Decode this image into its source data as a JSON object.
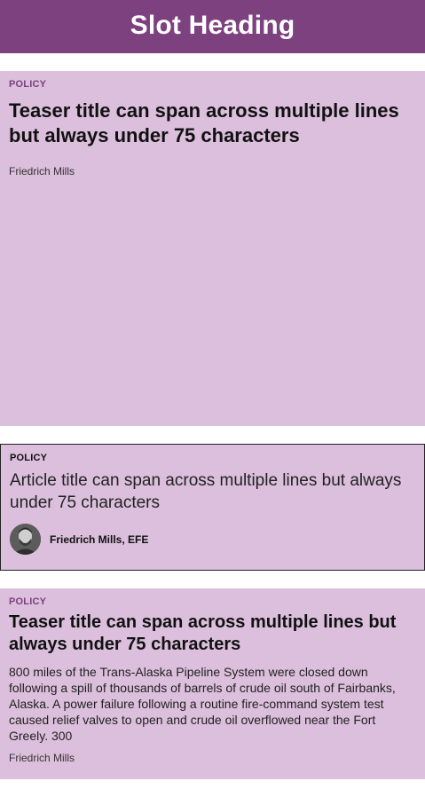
{
  "slot": {
    "heading": "Slot Heading"
  },
  "cards": [
    {
      "kicker": "POLICY",
      "title": "Teaser title can span across multiple lines but always under 75 characters",
      "byline": "Friedrich Mills"
    },
    {
      "kicker": "POLICY",
      "title": "Article title can span across multiple lines but always under 75 characters",
      "author": "Friedrich Mills, EFE",
      "avatar_icon": "author-avatar"
    },
    {
      "kicker": "POLICY",
      "title": "Teaser title can span across multiple lines but always under 75 characters",
      "summary": "800 miles of the Trans-Alaska Pipeline System were closed down following a spill of thousands of barrels of crude oil south of Fairbanks, Alaska. A power failure following a routine fire-command system test caused relief valves to open and crude oil overflowed near the Fort Greely. 300",
      "byline": "Friedrich Mills"
    }
  ],
  "colors": {
    "header_bg": "#7c417e",
    "card_bg": "#dbbfdc",
    "kicker": "#7c417e"
  }
}
